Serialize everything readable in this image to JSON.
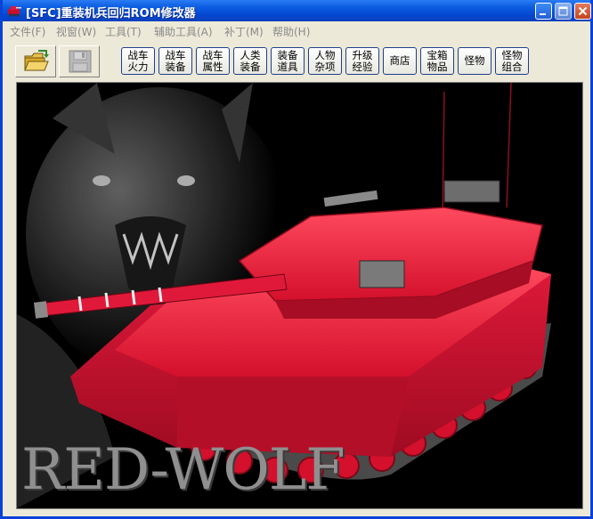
{
  "window": {
    "title": "[SFC]重装机兵回归ROM修改器"
  },
  "menu": [
    {
      "label": "文件(F)"
    },
    {
      "label": "视窗(W)"
    },
    {
      "label": "工具(T)"
    },
    {
      "label": "辅助工具(A)"
    },
    {
      "label": "补丁(M)"
    },
    {
      "label": "帮助(H)"
    }
  ],
  "toolbar": {
    "buttons": [
      {
        "line1": "战车",
        "line2": "火力"
      },
      {
        "line1": "战车",
        "line2": "装备"
      },
      {
        "line1": "战车",
        "line2": "属性"
      },
      {
        "line1": "人类",
        "line2": "装备"
      },
      {
        "line1": "装备",
        "line2": "道具"
      },
      {
        "line1": "人物",
        "line2": "杂项"
      },
      {
        "line1": "升级",
        "line2": "经验"
      },
      {
        "line1": "商店",
        "line2": ""
      },
      {
        "line1": "宝箱",
        "line2": "物品"
      },
      {
        "line1": "怪物",
        "line2": ""
      },
      {
        "line1": "怪物",
        "line2": "组合"
      }
    ]
  },
  "splash": {
    "logo_text": "RED-WOLF"
  },
  "colors": {
    "tank_red": "#e0193a",
    "title_blue": "#0a5ce0"
  }
}
